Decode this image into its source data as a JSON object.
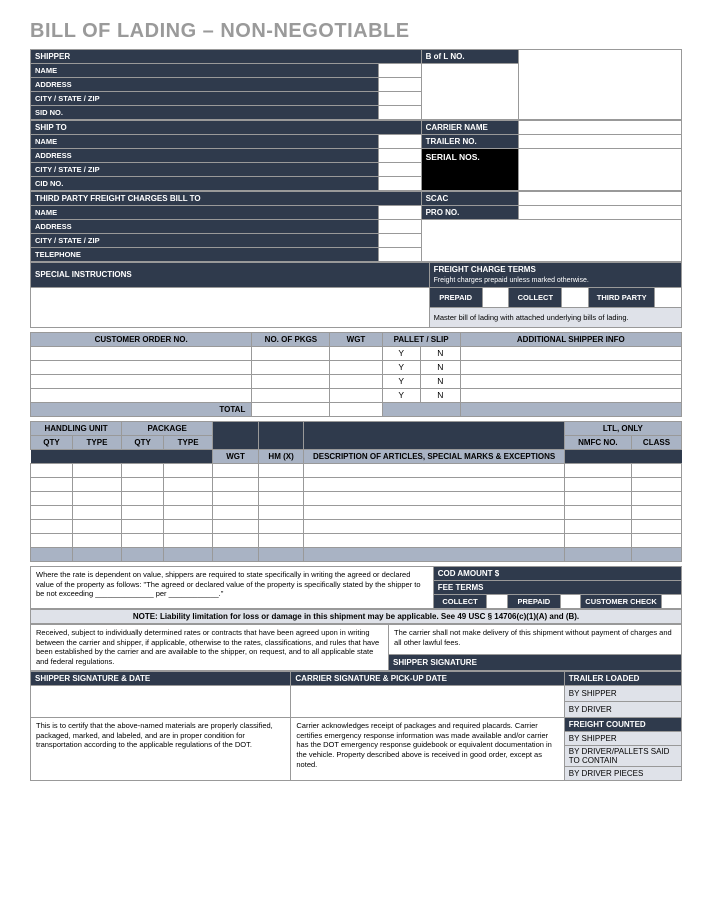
{
  "title": "BILL OF LADING – NON-NEGOTIABLE",
  "shipper": {
    "header": "SHIPPER",
    "name": "NAME",
    "address": "ADDRESS",
    "csz": "CITY / STATE / ZIP",
    "sid": "SID NO."
  },
  "bol_header": "B of L NO.",
  "shipto": {
    "header": "SHIP TO",
    "name": "NAME",
    "address": "ADDRESS",
    "csz": "CITY / STATE / ZIP",
    "cid": "CID NO."
  },
  "carrier": {
    "name": "CARRIER NAME",
    "trailer": "TRAILER NO.",
    "serial": "SERIAL NOS."
  },
  "third": {
    "header": "THIRD PARTY FREIGHT CHARGES BILL TO",
    "name": "NAME",
    "address": "ADDRESS",
    "csz": "CITY / STATE / ZIP",
    "tel": "TELEPHONE"
  },
  "scac": "SCAC",
  "pro": "PRO NO.",
  "special": "SPECIAL INSTRUCTIONS",
  "freight": {
    "header": "FREIGHT CHARGE TERMS",
    "sub": "Freight charges prepaid unless marked otherwise.",
    "prepaid": "PREPAID",
    "collect": "COLLECT",
    "thirdparty": "THIRD PARTY",
    "master": "Master bill of lading with attached underlying bills of lading."
  },
  "orders": {
    "col_order": "CUSTOMER ORDER NO.",
    "col_pkgs": "NO. OF PKGS",
    "col_wgt": "WGT",
    "col_pallet": "PALLET / SLIP",
    "col_add": "ADDITIONAL SHIPPER INFO",
    "y": "Y",
    "n": "N",
    "total": "TOTAL"
  },
  "carrier_info": {
    "handling": "HANDLING UNIT",
    "package": "PACKAGE",
    "ltl": "LTL, ONLY",
    "qty": "QTY",
    "type": "TYPE",
    "wgt": "WGT",
    "hm": "HM (X)",
    "desc": "DESCRIPTION OF ARTICLES, SPECIAL MARKS & EXCEPTIONS",
    "nmfc": "NMFC NO.",
    "class": "CLASS"
  },
  "rate_text": "Where the rate is dependent on value, shippers are required to state specifically in writing the agreed or declared value of the property as follows: \"The agreed or declared value of the property is specifically stated by the shipper to be not exceeding ______________ per ____________.\"",
  "cod": {
    "amount": "COD AMOUNT $",
    "fee": "FEE TERMS",
    "collect": "COLLECT",
    "prepaid": "PREPAID",
    "check": "CUSTOMER CHECK"
  },
  "liability_note": "NOTE: Liability limitation for loss or damage in this shipment may be applicable. See 49 USC § 14706(c)(1)(A) and (B).",
  "received_text": "Received, subject to individually determined rates or contracts that have been agreed upon in writing between the carrier and shipper, if applicable, otherwise to the rates, classifications, and rules that have been established by the carrier and are available to the shipper, on request, and to all applicable state and federal regulations.",
  "carrier_cert_text": "The carrier shall not make delivery of this shipment without payment of charges and all other lawful fees.",
  "shipper_sig": "SHIPPER SIGNATURE",
  "sig_date": "SHIPPER SIGNATURE & DATE",
  "carrier_sig": "CARRIER SIGNATURE & PICK-UP DATE",
  "trailer_loaded": "TRAILER LOADED",
  "freight_counted": "FREIGHT COUNTED",
  "by_shipper": "BY SHIPPER",
  "by_driver": "BY DRIVER",
  "by_driver_pallets": "BY DRIVER/PALLETS SAID TO CONTAIN",
  "by_driver_pieces": "BY DRIVER PIECES",
  "certify_text": "This is to certify that the above-named materials are properly classified, packaged, marked, and labeled, and are in proper condition for transportation according to the applicable regulations of the DOT.",
  "carrier_ack_text": "Carrier acknowledges receipt of packages and required placards. Carrier certifies emergency response information was made available and/or carrier has the DOT emergency response guidebook or equivalent documentation in the vehicle. Property described above is received in good order, except as noted."
}
